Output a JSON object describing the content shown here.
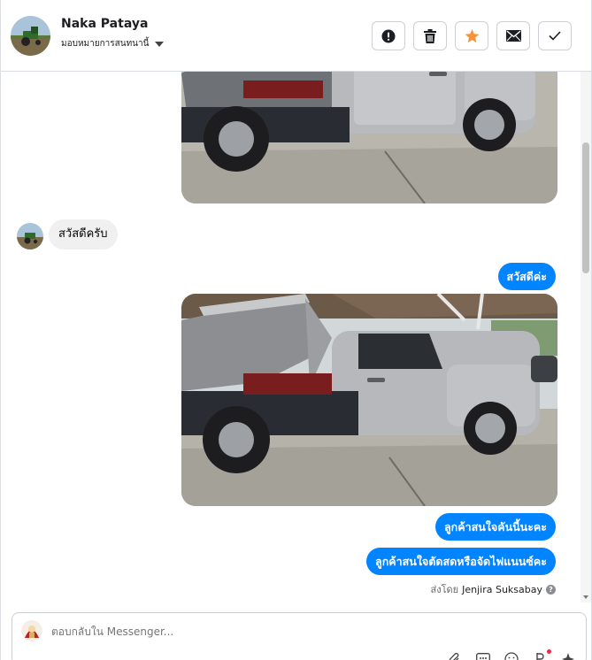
{
  "header": {
    "contact_name": "Naka Pataya",
    "assign_label": "มอบหมายการสนทนานี้",
    "actions": [
      {
        "name": "report-spam-button",
        "icon": "exclamation-circle-icon"
      },
      {
        "name": "delete-button",
        "icon": "trash-icon"
      },
      {
        "name": "star-button",
        "icon": "star-icon"
      },
      {
        "name": "mark-unread-button",
        "icon": "envelope-icon"
      },
      {
        "name": "mark-done-button",
        "icon": "check-icon"
      }
    ]
  },
  "messages": {
    "incoming_1": "สวัสดีครับ",
    "outgoing_1": "สวัสดีค่ะ",
    "outgoing_2": "ลูกค้าสนใจคันนี้นะคะ",
    "outgoing_3": "ลูกค้าสนใจตัดสดหรือจัดไฟแนนซ์คะ"
  },
  "sent_by": {
    "prefix": "ส่งโดย",
    "name": "Jenjira Suksabay",
    "help": "?"
  },
  "composer": {
    "placeholder": "ตอบกลับใน Messenger...",
    "tools": [
      "attachment-icon",
      "saved-replies-icon",
      "emoji-icon",
      "payment-icon",
      "more-icon"
    ]
  },
  "colors": {
    "outgoing_bubble": "#0084ff",
    "incoming_bubble": "#f0f0f0",
    "star": "#f7923a",
    "notification_dot": "#f02849"
  }
}
